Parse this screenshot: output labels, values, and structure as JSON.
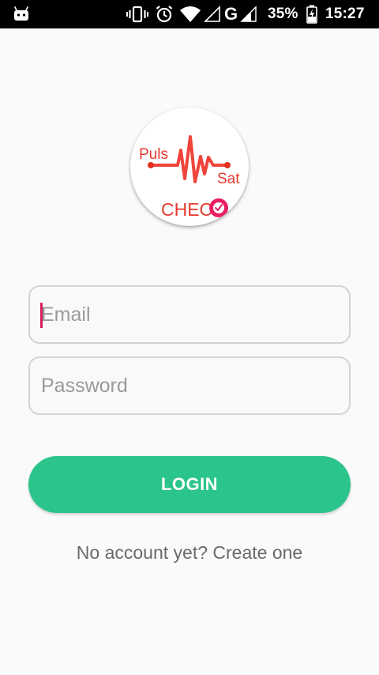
{
  "status_bar": {
    "battery_percent": "35%",
    "time": "15:27",
    "network_type": "G",
    "icons": [
      "android-icon",
      "vibrate-icon",
      "alarm-icon",
      "wifi-icon",
      "signal-icon",
      "signal-icon",
      "battery-charging-icon"
    ]
  },
  "logo": {
    "line1": "Puls",
    "line2": "Sat",
    "line3": "CHECK",
    "colors": {
      "wave": "#f0443a",
      "dot": "#e0321e",
      "text_red": "#e53a2f",
      "badge": "#e91e63"
    }
  },
  "form": {
    "email_placeholder": "Email",
    "password_placeholder": "Password",
    "login_label": "LOGIN"
  },
  "footer": {
    "create_account": "No account yet? Create one"
  },
  "colors": {
    "accent": "#2bc48a",
    "background": "#fafafa",
    "cursor": "#d81b60"
  }
}
